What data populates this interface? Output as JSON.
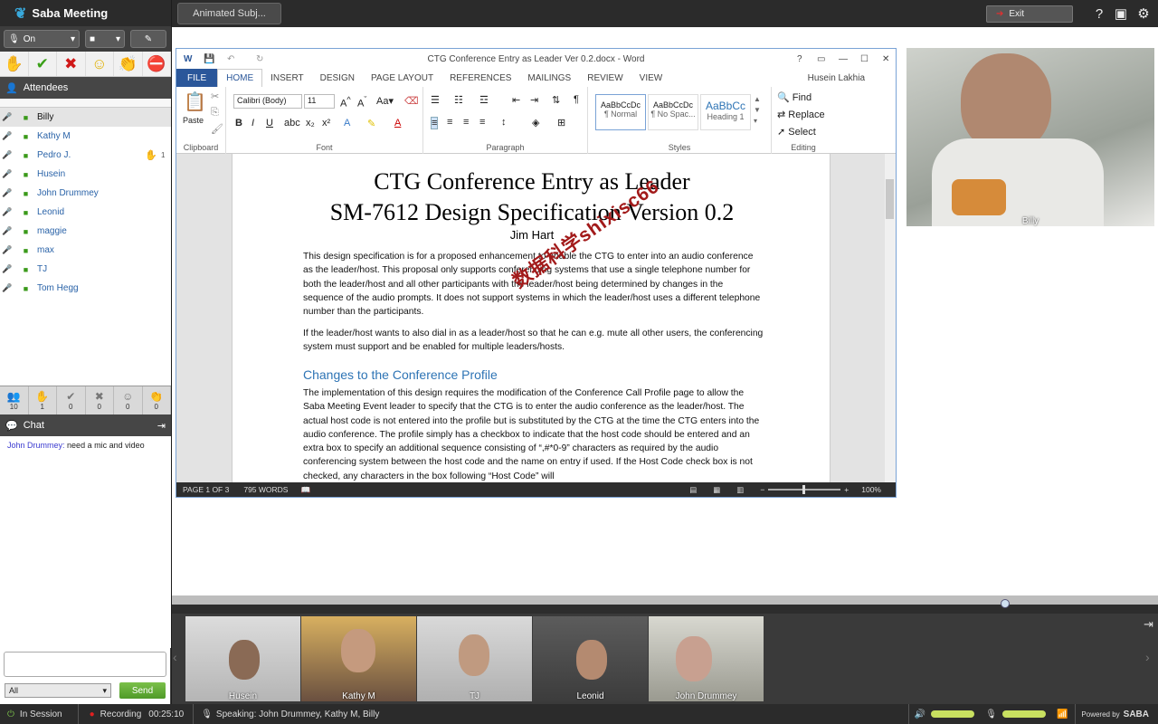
{
  "app": {
    "name": "Saba Meeting",
    "tab_title": "Animated Subj...",
    "exit_label": "Exit"
  },
  "controls": {
    "mic_state": "On"
  },
  "attendees": {
    "header": "Attendees",
    "list": [
      {
        "name": "Billy",
        "selected": true,
        "hand": ""
      },
      {
        "name": "Kathy M",
        "selected": false,
        "hand": ""
      },
      {
        "name": "Pedro J.",
        "selected": false,
        "hand": "✋",
        "count": "1"
      },
      {
        "name": "Husein",
        "selected": false,
        "hand": ""
      },
      {
        "name": "John Drummey",
        "selected": false,
        "hand": ""
      },
      {
        "name": "Leonid",
        "selected": false,
        "hand": ""
      },
      {
        "name": "maggie",
        "selected": false,
        "hand": ""
      },
      {
        "name": "max",
        "selected": false,
        "hand": ""
      },
      {
        "name": "TJ",
        "selected": false,
        "hand": ""
      },
      {
        "name": "Tom Hegg",
        "selected": false,
        "hand": ""
      }
    ],
    "counts": [
      "10",
      "1",
      "0",
      "0",
      "0",
      "0"
    ]
  },
  "chat": {
    "header": "Chat",
    "messages": [
      {
        "sender": "John Drummey:",
        "text": "need a mic and video"
      }
    ],
    "to": "All",
    "send_label": "Send"
  },
  "word": {
    "window_title": "CTG Conference Entry as Leader Ver 0.2.docx - Word",
    "user": "Husein Lakhia",
    "tabs": [
      "FILE",
      "HOME",
      "INSERT",
      "DESIGN",
      "PAGE LAYOUT",
      "REFERENCES",
      "MAILINGS",
      "REVIEW",
      "VIEW"
    ],
    "font": "Calibri (Body)",
    "font_size": "11",
    "paste_label": "Paste",
    "groups": [
      "Clipboard",
      "Font",
      "Paragraph",
      "Styles",
      "Editing"
    ],
    "styles": [
      {
        "preview": "AaBbCcDc",
        "name": "¶ Normal"
      },
      {
        "preview": "AaBbCcDc",
        "name": "¶ No Spac..."
      },
      {
        "preview": "AaBbCc",
        "name": "Heading 1"
      }
    ],
    "editing": [
      "Find",
      "Replace",
      "Select"
    ],
    "doc": {
      "title_line1": "CTG Conference Entry as Leader",
      "title_line2": "SM-7612 Design Specification Version 0.2",
      "author": "Jim Hart",
      "para1": "This design specification is for a proposed enhancement to enable the CTG to enter into an audio conference as the leader/host. This proposal only supports conferencing systems that use a single telephone number for both the leader/host and all other participants with the leader/host being determined by changes in the sequence of the audio prompts. It does not support systems in which the leader/host uses a different telephone number than the participants.",
      "para2": "If the leader/host wants to also dial in as a leader/host so that he can e.g. mute all other users, the conferencing system must support and be enabled for multiple leaders/hosts.",
      "heading": "Changes to the Conference Profile",
      "para3": "The implementation of this design requires the modification of the Conference Call Profile page to allow the Saba Meeting Event leader to specify that the CTG is to enter the audio conference as the leader/host. The actual host code is not entered into the profile but is substituted by the CTG at the time the CTG enters into the audio conference. The profile simply has a checkbox to indicate that the host code should be entered and an extra box to specify an additional sequence consisting of “,#*0-9” characters as required by the audio conferencing system between the host code and the name on entry if used. If the Host Code check box is not checked, any characters in the box following “Host Code” will"
    },
    "status": {
      "page": "PAGE 1 OF 3",
      "words": "795 WORDS",
      "zoom": "100%"
    },
    "watermark": "数据科学shixisc66"
  },
  "video": {
    "main": "Billy",
    "thumbs": [
      "Husein",
      "Kathy M",
      "TJ",
      "Leonid",
      "John Drummey"
    ]
  },
  "bottom": {
    "session": "In Session",
    "recording": "Recording",
    "timer": "00:25:10",
    "speaking": "Speaking: John Drummey, Kathy M, Billy",
    "powered": "Powered by",
    "brand": "SABA"
  }
}
